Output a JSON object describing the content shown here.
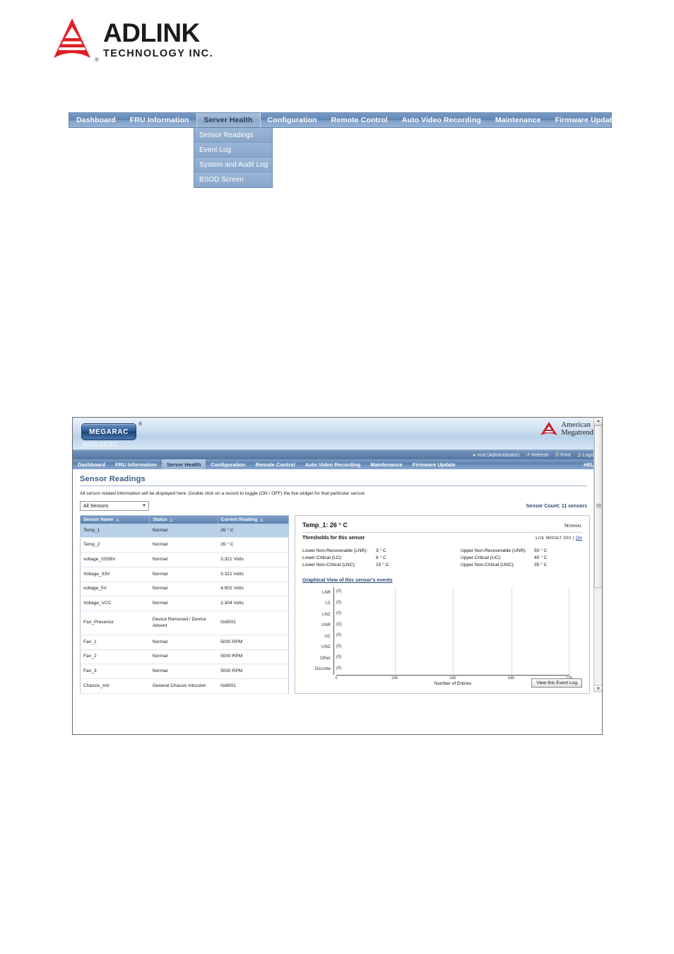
{
  "brand": {
    "name": "ADLINK",
    "tagline": "TECHNOLOGY INC.",
    "registered": "®"
  },
  "top_nav_figure": {
    "items": [
      {
        "label": "Dashboard",
        "active": false
      },
      {
        "label": "FRU Information",
        "active": false
      },
      {
        "label": "Server Health",
        "active": true
      },
      {
        "label": "Configuration",
        "active": false
      },
      {
        "label": "Remote Control",
        "active": false
      },
      {
        "label": "Auto Video Recording",
        "active": false
      },
      {
        "label": "Maintenance",
        "active": false
      },
      {
        "label": "Firmware Update",
        "active": false
      }
    ],
    "dropdown": {
      "parent": "Server Health",
      "items": [
        {
          "label": "Sensor Readings"
        },
        {
          "label": "Event Log"
        },
        {
          "label": "System and Audit Log"
        },
        {
          "label": "BSOD Screen"
        }
      ]
    }
  },
  "screenshot": {
    "header": {
      "product_logo": "MEGARAC",
      "product_logo_mark": "®",
      "product_logo_ghost": "MEGARAC",
      "vendor_line1": "American",
      "vendor_line2": "Megatrends",
      "vendor_icon": "american-megatrends-triangle-icon"
    },
    "userbar": {
      "user": "root (Administrator)",
      "user_icon": "user-icon",
      "refresh": "Refresh",
      "refresh_icon": "refresh-icon",
      "print": "Print",
      "print_icon": "printer-icon",
      "logout": "Logout",
      "logout_icon": "logout-icon"
    },
    "nav": {
      "items": [
        {
          "label": "Dashboard",
          "active": false
        },
        {
          "label": "FRU Information",
          "active": false
        },
        {
          "label": "Server Health",
          "active": true
        },
        {
          "label": "Configuration",
          "active": false
        },
        {
          "label": "Remote Control",
          "active": false
        },
        {
          "label": "Auto Video Recording",
          "active": false
        },
        {
          "label": "Maintenance",
          "active": false
        },
        {
          "label": "Firmware Update",
          "active": false
        }
      ],
      "help": "HELP"
    },
    "page": {
      "title": "Sensor Readings",
      "description": "All sensor related information will be displayed here. Double click on a record to toggle (ON / OFF) the live widget for that particular sensor.",
      "filter_value": "All Sensors",
      "filter_caret": "▼",
      "sensor_count": "Sensor Count: 11 sensors"
    },
    "table": {
      "columns": [
        {
          "label": "Sensor Name",
          "sort": "△"
        },
        {
          "label": "Status",
          "sort": "△"
        },
        {
          "label": "Current Reading",
          "sort": "△"
        }
      ],
      "rows": [
        {
          "name": "Temp_1",
          "status": "Normal",
          "reading": "26 ° C",
          "selected": true
        },
        {
          "name": "Temp_2",
          "status": "Normal",
          "reading": "26 ° C",
          "selected": false
        },
        {
          "name": "voltage_33SBV",
          "status": "Normal",
          "reading": "3.321 Volts",
          "selected": false
        },
        {
          "name": "Voltage_33V",
          "status": "Normal",
          "reading": "3.321 Volts",
          "selected": false
        },
        {
          "name": "voltage_5V",
          "status": "Normal",
          "reading": "4.902 Volts",
          "selected": false
        },
        {
          "name": "Voltage_VCC",
          "status": "Normal",
          "reading": "2.304 Volts",
          "selected": false
        },
        {
          "name": "Fan_Presence",
          "status": "Device Removed / Device Absent",
          "reading": "0x8001",
          "selected": false
        },
        {
          "name": "Fan_1",
          "status": "Normal",
          "reading": "5000 RPM",
          "selected": false
        },
        {
          "name": "Fan_2",
          "status": "Normal",
          "reading": "5000 RPM",
          "selected": false
        },
        {
          "name": "Fan_3",
          "status": "Normal",
          "reading": "5000 RPM",
          "selected": false
        },
        {
          "name": "Chassis_Intr",
          "status": "General Chassis Intrusion",
          "reading": "0x8001",
          "selected": false
        }
      ]
    },
    "detail": {
      "title": "Temp_1: 26 ° C",
      "state": "Normal",
      "thresholds_label": "Thresholds for this sensor",
      "live_widget_label": "Live Widget",
      "live_widget_off": "Off",
      "live_widget_sep": "|",
      "live_widget_on": "On",
      "lower": [
        {
          "label": "Lower Non-Recoverable (LNR):",
          "value": "3 ° C"
        },
        {
          "label": "Lower Critical (LC):",
          "value": "8 ° C"
        },
        {
          "label": "Lower Non-Critical (LNC):",
          "value": "15 ° C"
        }
      ],
      "upper": [
        {
          "label": "Upper Non-Recoverable (UNR):",
          "value": "50 ° C"
        },
        {
          "label": "Upper Critical (UC):",
          "value": "40 ° C"
        },
        {
          "label": "Upper Non-Critical (UNC):",
          "value": "35 ° C"
        }
      ],
      "graph_title": "Graphical View of this sensor's events",
      "view_log_button": "View this Event Log"
    },
    "chart_data": {
      "type": "bar",
      "orientation": "horizontal",
      "title": "Graphical View of this sensor's events",
      "categories": [
        "LNR",
        "LC",
        "LNC",
        "UNR",
        "UC",
        "UNC",
        "Other",
        "Discrete"
      ],
      "values": [
        0,
        0,
        0,
        0,
        0,
        0,
        0,
        0
      ],
      "value_labels": [
        "(0)",
        "(0)",
        "(0)",
        "(0)",
        "(0)",
        "(0)",
        "(0)",
        "(0)"
      ],
      "xlabel": "Number of Entries",
      "ylabel": "",
      "xlim": [
        0,
        780
      ],
      "xticks": [
        0,
        195,
        390,
        585,
        778
      ],
      "xtick_labels": [
        "0",
        "195",
        "390",
        "585",
        "778"
      ],
      "grid": true,
      "legend": false
    }
  }
}
